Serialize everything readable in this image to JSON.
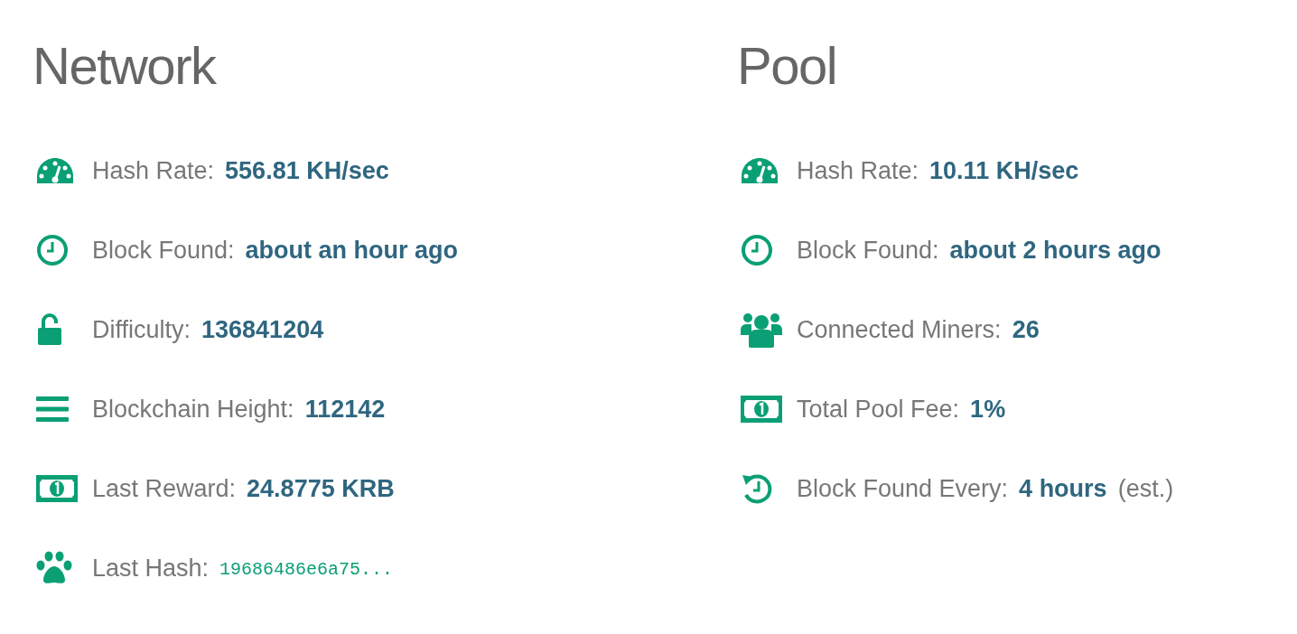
{
  "sections": [
    {
      "title": "Network",
      "stats": [
        {
          "label": "Hash Rate:",
          "value": "556.81 KH/sec",
          "kind": "text"
        },
        {
          "label": "Block Found:",
          "value": "about an hour ago",
          "kind": "text"
        },
        {
          "label": "Difficulty:",
          "value": "136841204",
          "kind": "text"
        },
        {
          "label": "Blockchain Height:",
          "value": "112142",
          "kind": "text"
        },
        {
          "label": "Last Reward:",
          "value": "24.8775 KRB",
          "kind": "text"
        },
        {
          "label": "Last Hash:",
          "value": "19686486e6a75...",
          "kind": "hash"
        }
      ]
    },
    {
      "title": "Pool",
      "stats": [
        {
          "label": "Hash Rate:",
          "value": "10.11 KH/sec",
          "kind": "text"
        },
        {
          "label": "Block Found:",
          "value": "about 2 hours ago",
          "kind": "text"
        },
        {
          "label": "Connected Miners:",
          "value": "26",
          "kind": "text"
        },
        {
          "label": "Total Pool Fee:",
          "value": "1%",
          "kind": "text"
        },
        {
          "label": "Block Found Every:",
          "value": "4 hours",
          "kind": "text",
          "note": "(est.)"
        }
      ]
    }
  ]
}
